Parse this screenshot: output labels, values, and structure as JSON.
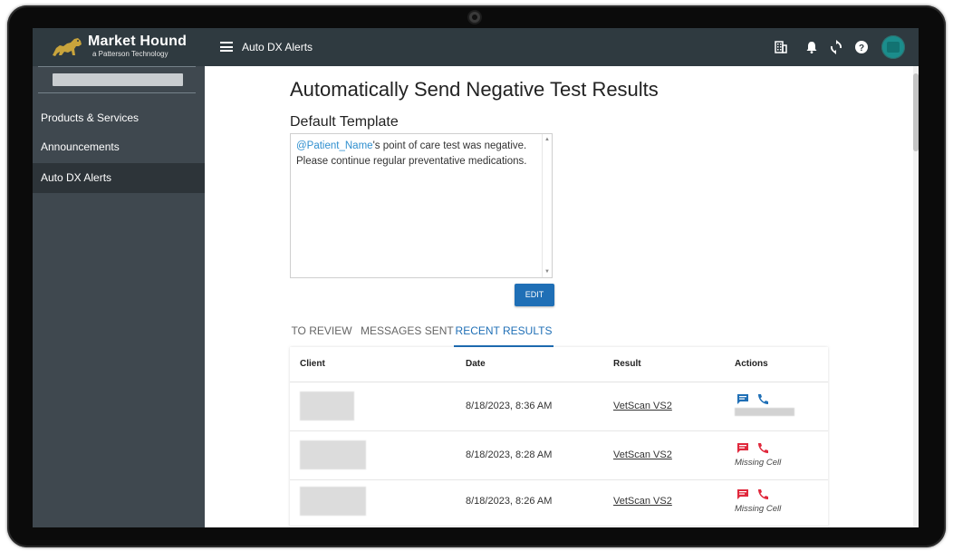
{
  "app": {
    "brand_name": "Market Hound",
    "brand_sub": "a Patterson Technology"
  },
  "sidebar": {
    "items": [
      {
        "label": "Products & Services",
        "active": false
      },
      {
        "label": "Announcements",
        "active": false
      },
      {
        "label": "Auto DX Alerts",
        "active": true
      }
    ]
  },
  "topbar": {
    "title": "Auto DX Alerts",
    "icons": [
      "building-icon",
      "bell-icon",
      "sync-icon",
      "help-icon",
      "avatar"
    ]
  },
  "main": {
    "page_title": "Automatically Send Negative Test Results",
    "section_title": "Default Template",
    "template": {
      "mention": "@Patient_Name",
      "line1_rest": "'s point of care test was negative.",
      "line2": "Please continue regular preventative medications."
    },
    "edit_label": "EDIT",
    "tabs": [
      {
        "label": "TO REVIEW",
        "active": false
      },
      {
        "label": "MESSAGES SENT",
        "active": false
      },
      {
        "label": "RECENT RESULTS",
        "active": true
      }
    ],
    "table": {
      "headers": [
        "Client",
        "Date",
        "Result",
        "Actions"
      ],
      "rows": [
        {
          "date": "8/18/2023, 8:36 AM",
          "result": "VetScan VS2",
          "action_status": "",
          "action_color": "#1f6fb6"
        },
        {
          "date": "8/18/2023, 8:28 AM",
          "result": "VetScan VS2",
          "action_status": "Missing Cell",
          "action_color": "#e0283c"
        },
        {
          "date": "8/18/2023, 8:26 AM",
          "result": "VetScan VS2",
          "action_status": "Missing Cell",
          "action_color": "#e0283c"
        }
      ]
    }
  },
  "colors": {
    "sidebar_bg": "#3f484f",
    "topbar_bg": "#2f3a40",
    "accent": "#1f6fb6",
    "alert": "#e0283c",
    "avatar": "#1b8d8c"
  }
}
